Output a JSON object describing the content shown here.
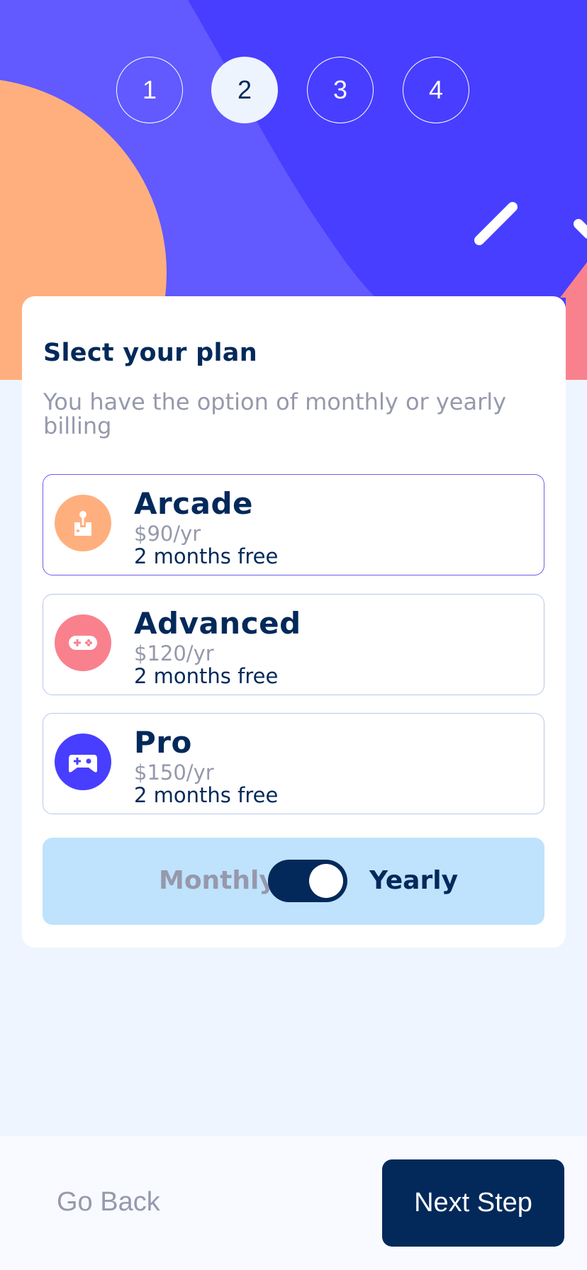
{
  "steps": [
    "1",
    "2",
    "3",
    "4"
  ],
  "active_step": "2",
  "card": {
    "title": "Slect your plan",
    "subtitle": "You have the option of monthly or yearly billing"
  },
  "plans": [
    {
      "name": "Arcade",
      "price": "$90/yr",
      "free": "2 months free",
      "icon": "arcade-icon",
      "color": "#ffaf7e",
      "selected": true
    },
    {
      "name": "Advanced",
      "price": "$120/yr",
      "free": "2 months free",
      "icon": "advanced-icon",
      "color": "#f9818e",
      "selected": false
    },
    {
      "name": "Pro",
      "price": "$150/yr",
      "free": "2 months free",
      "icon": "pro-icon",
      "color": "#483eff",
      "selected": false
    }
  ],
  "billing": {
    "monthly_label": "Monthly",
    "yearly_label": "Yearly",
    "selected": "Yearly"
  },
  "footer": {
    "back_label": "Go Back",
    "next_label": "Next Step"
  },
  "colors": {
    "primary": "#02295a",
    "accent": "#483eff",
    "muted": "#9699ab",
    "toggle_bg": "#bfe2fd"
  }
}
